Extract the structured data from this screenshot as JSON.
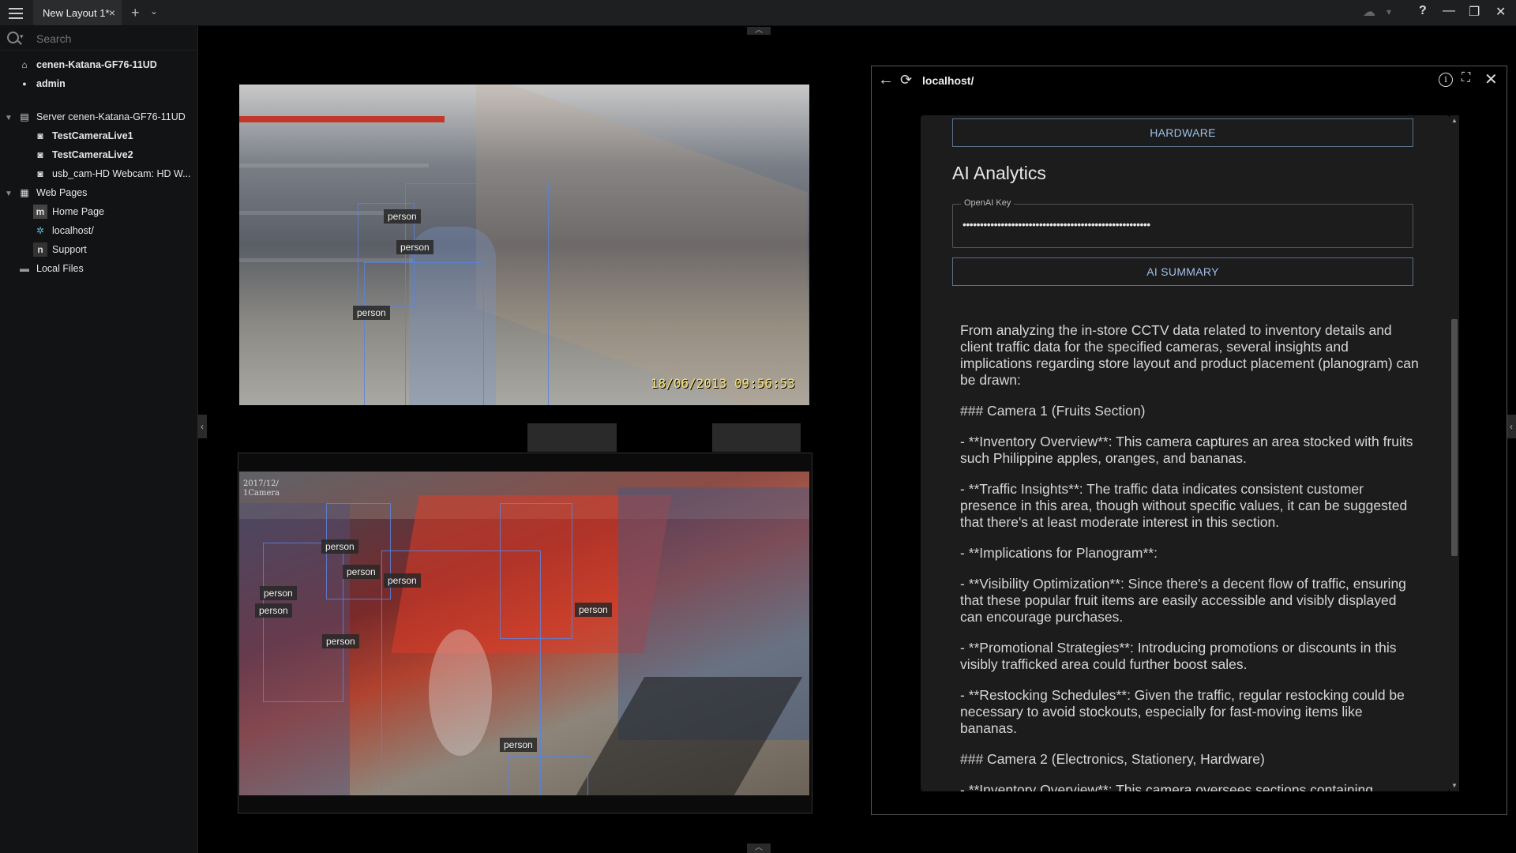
{
  "titlebar": {
    "tab_label": "New Layout 1*",
    "tab_close": "×",
    "add_tab": "+",
    "more_tabs": "⌄",
    "cloud_icon": "☁",
    "cloud_caret": "▾",
    "help": "?",
    "minimize": "—",
    "restore": "❐",
    "close": "✕"
  },
  "sidebar": {
    "search_placeholder": "Search",
    "items": [
      {
        "label": "cenen-Katana-GF76-11UD",
        "icon": "home-icon",
        "glyph": "⌂"
      },
      {
        "label": "admin",
        "icon": "user-icon",
        "glyph": "●"
      },
      {
        "label": "Server cenen-Katana-GF76-11UD",
        "icon": "server-icon",
        "glyph": "▤"
      },
      {
        "label": "TestCameraLive1",
        "icon": "camera-icon",
        "glyph": "◙"
      },
      {
        "label": "TestCameraLive2",
        "icon": "camera-icon",
        "glyph": "◙"
      },
      {
        "label": "usb_cam-HD Webcam: HD W...",
        "icon": "camera-icon",
        "glyph": "◙"
      },
      {
        "label": "Web Pages",
        "icon": "webpages-icon",
        "glyph": "▦"
      },
      {
        "label": "Home Page",
        "icon": "m-logo-icon",
        "glyph": "m"
      },
      {
        "label": "localhost/",
        "icon": "react-icon",
        "glyph": "✲"
      },
      {
        "label": "Support",
        "icon": "n-logo-icon",
        "glyph": "n"
      },
      {
        "label": "Local Files",
        "icon": "folder-icon",
        "glyph": "▬"
      }
    ]
  },
  "camera1": {
    "timestamp": "18/06/2013 09:56:53",
    "labels": [
      "person",
      "person",
      "person"
    ]
  },
  "camera2": {
    "timestamp_line1": "2017/12/",
    "timestamp_line2": "1Camera",
    "labels": [
      "person",
      "person",
      "person",
      "person",
      "person",
      "person",
      "person",
      "person"
    ]
  },
  "webpanel": {
    "address": "localhost/",
    "hardware_button": "HARDWARE",
    "section_title": "AI Analytics",
    "openai_label": "OpenAI Key",
    "openai_value": "••••••••••••••••••••••••••••••••••••••••••••••••••••••",
    "ai_summary_button": "AI SUMMARY",
    "summary": [
      "From analyzing the in-store CCTV data related to inventory details and client traffic data for the specified cameras, several insights and implications regarding store layout and product placement (planogram) can be drawn:",
      "### Camera 1 (Fruits Section)",
      "- **Inventory Overview**: This camera captures an area stocked with fruits such Philippine apples, oranges, and bananas.",
      "- **Traffic Insights**: The traffic data indicates consistent customer presence in this area, though without specific values, it can be suggested that there's at least moderate interest in this section.",
      "- **Implications for Planogram**:",
      "- **Visibility Optimization**: Since there's a decent flow of traffic, ensuring that these popular fruit items are easily accessible and visibly displayed can encourage purchases.",
      "- **Promotional Strategies**: Introducing promotions or discounts in this visibly trafficked area could further boost sales.",
      "- **Restocking Schedules**: Given the traffic, regular restocking could be necessary to avoid stockouts, especially for fast-moving items like bananas.",
      "### Camera 2 (Electronics, Stationery, Hardware)",
      "- **Inventory Overview**: This camera oversees sections containing"
    ]
  }
}
